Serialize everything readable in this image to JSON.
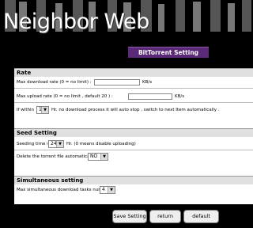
{
  "app": {
    "logo": "Neighbor Web",
    "page_heading": "BitTorrent Setting"
  },
  "rate": {
    "title": "Rate",
    "max_download_label": "Max download rate (0 = no limit) :",
    "max_download_value": "",
    "max_download_unit": "KB/s",
    "max_upload_label": "Max upload rate (0 = no limit , default 20 ) :",
    "max_upload_value": "",
    "max_upload_unit": "KB/s",
    "within_prefix": "If within",
    "within_value": "1",
    "within_suffix": "Hr. no download process it will auto stop , switch to next Item automatically ."
  },
  "seed": {
    "title": "Seed Setting",
    "seeding_prefix": "Seeding time is",
    "seeding_value": "24",
    "seeding_suffix": "Hr. (0 means disable uploading)",
    "delete_label": "Delete the torrent file automatically",
    "delete_value": "NO"
  },
  "simul": {
    "title": "Simultaneous setting",
    "max_tasks_label": "Max simultaneous download tasks number",
    "max_tasks_value": "4"
  },
  "buttons": {
    "save": "Save Setting",
    "return": "return",
    "default": "default"
  }
}
